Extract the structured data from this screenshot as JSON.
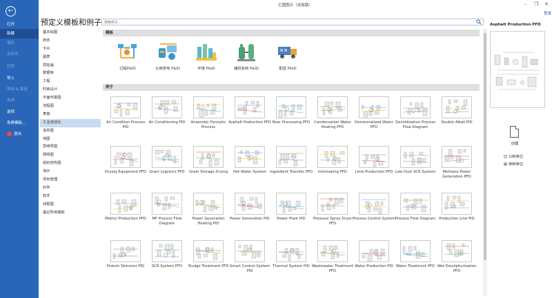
{
  "window": {
    "title": "亿图图示（试用版）",
    "minimize": "–",
    "restore": "❐",
    "close": "✕",
    "login": "登录"
  },
  "sidebar": {
    "back_icon": "←",
    "items": [
      {
        "label": "打开",
        "dim": false,
        "active": false
      },
      {
        "label": "新建",
        "dim": false,
        "active": true
      },
      {
        "label": "保存",
        "dim": true,
        "active": false
      },
      {
        "label": "另存为",
        "dim": true,
        "active": false
      },
      {
        "label": "打印",
        "dim": true,
        "active": false
      },
      {
        "label": "导入",
        "dim": false,
        "active": false
      },
      {
        "label": "导出 & 发送",
        "dim": true,
        "active": false
      },
      {
        "label": "关闭",
        "dim": true,
        "active": false
      },
      {
        "label": "选项",
        "dim": false,
        "active": false
      },
      {
        "label": "免费模板...",
        "dim": false,
        "active": false
      },
      {
        "label": "退出",
        "dim": false,
        "active": false
      }
    ]
  },
  "heading": "预定义模板和例子",
  "search": {
    "placeholder": "搜索例子..."
  },
  "categories": [
    "基本绘图",
    "商务",
    "卡片",
    "图表",
    "剪贴画",
    "数据库",
    "工程",
    "时装设计",
    "平面布置图",
    "流程图",
    "表格",
    "工业自动化",
    "信息图",
    "地图",
    "思维导图",
    "网络图",
    "组织结构图",
    "演示",
    "项目管理",
    "科学",
    "软件",
    "线框图",
    "最近所用模板"
  ],
  "active_category": 11,
  "templates_section": "模板",
  "examples_section": "例子",
  "templates": [
    {
      "label": "过程P&ID",
      "icon": "process-pid-icon"
    },
    {
      "label": "公用发电 P&ID",
      "icon": "utility-power-pid-icon"
    },
    {
      "label": "环境 P&ID",
      "icon": "environment-pid-icon"
    },
    {
      "label": "辅机系统 P&ID",
      "icon": "auxiliary-system-pid-icon"
    },
    {
      "label": "配送 P&ID",
      "icon": "delivery-truck-icon"
    }
  ],
  "examples": [
    "Air Condition Process PID",
    "Air Conditioning PID",
    "Anaerobic Pyrolytic Process",
    "Asphalt Production PFD",
    "Beer Processing PFD",
    "Condensation Water Heating PFD",
    "Demineralized Water PFD",
    "Decoldization Process Flow Diagram",
    "Double Alkali PID",
    "Drying Equipment PFD",
    "Grain Logistics PFD",
    "Grain Storage Drying",
    "Hot Water System",
    "Ingredient Transfer PFD",
    "Ironmaking PFD",
    "Lime Production PFD",
    "Low Dust SCR System",
    "Methane Power Generation PFD",
    "Methyl Production PFD",
    "MF Process Flow Diagram",
    "Power Generation Heating PID",
    "Power Generation PID",
    "Power Plant PID",
    "Pressure Spray Dryer PFD",
    "Process Control System",
    "Process Flow Diagram",
    "Production Line PID",
    "Protein Skimmer PID",
    "SCR System PFD",
    "Sludge Treatment PFD",
    "Smart Control System PID",
    "Thermal System PID",
    "Wastewater Treatment PFD",
    "Water Production PID",
    "Water Treatment PFD",
    "Wet Desulphurization PFD"
  ],
  "preview": {
    "title": "Asphalt Production PFD"
  },
  "create": {
    "label": "创建"
  },
  "units": [
    {
      "label": "公制单位",
      "selected": false
    },
    {
      "label": "英制单位",
      "selected": true
    }
  ],
  "colors": {
    "sidebar": "#2a66b8",
    "active_category": "#c9daf1",
    "accent": "#2a66b8"
  }
}
